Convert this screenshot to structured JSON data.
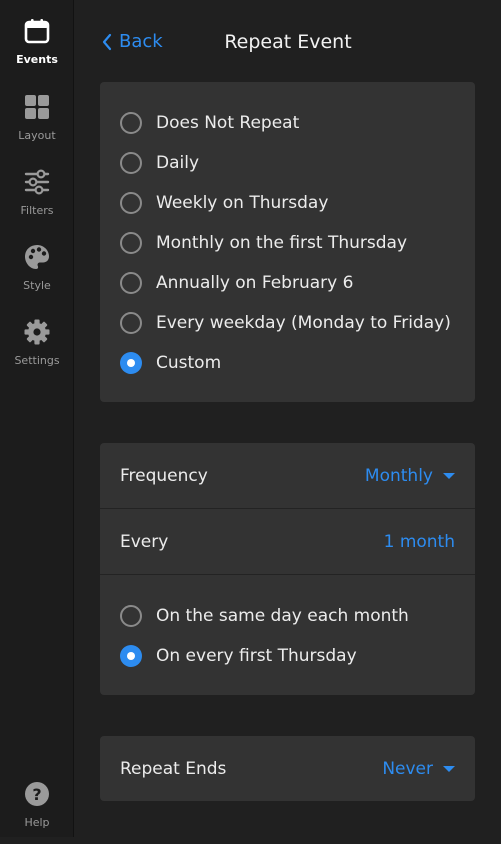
{
  "sidebar": {
    "items": [
      {
        "label": "Events",
        "icon": "calendar-icon",
        "active": true
      },
      {
        "label": "Layout",
        "icon": "layout-icon",
        "active": false
      },
      {
        "label": "Filters",
        "icon": "sliders-icon",
        "active": false
      },
      {
        "label": "Style",
        "icon": "palette-icon",
        "active": false
      },
      {
        "label": "Settings",
        "icon": "gear-icon",
        "active": false
      }
    ],
    "help": {
      "label": "Help",
      "icon": "question-icon"
    }
  },
  "header": {
    "back_label": "Back",
    "title": "Repeat Event"
  },
  "repeat_options": [
    {
      "label": "Does Not Repeat",
      "selected": false
    },
    {
      "label": "Daily",
      "selected": false
    },
    {
      "label": "Weekly on Thursday",
      "selected": false
    },
    {
      "label": "Monthly on the first Thursday",
      "selected": false
    },
    {
      "label": "Annually on February 6",
      "selected": false
    },
    {
      "label": "Every weekday (Monday to Friday)",
      "selected": false
    },
    {
      "label": "Custom",
      "selected": true
    }
  ],
  "custom": {
    "frequency_label": "Frequency",
    "frequency_value": "Monthly",
    "every_label": "Every",
    "every_value": "1 month",
    "monthly_options": [
      {
        "label": "On the same day each month",
        "selected": false
      },
      {
        "label": "On every first Thursday",
        "selected": true
      }
    ]
  },
  "repeat_ends": {
    "label": "Repeat Ends",
    "value": "Never"
  },
  "colors": {
    "accent": "#2d8cf0",
    "background": "#202020",
    "card": "#333333",
    "sidebar": "#1c1c1c"
  }
}
